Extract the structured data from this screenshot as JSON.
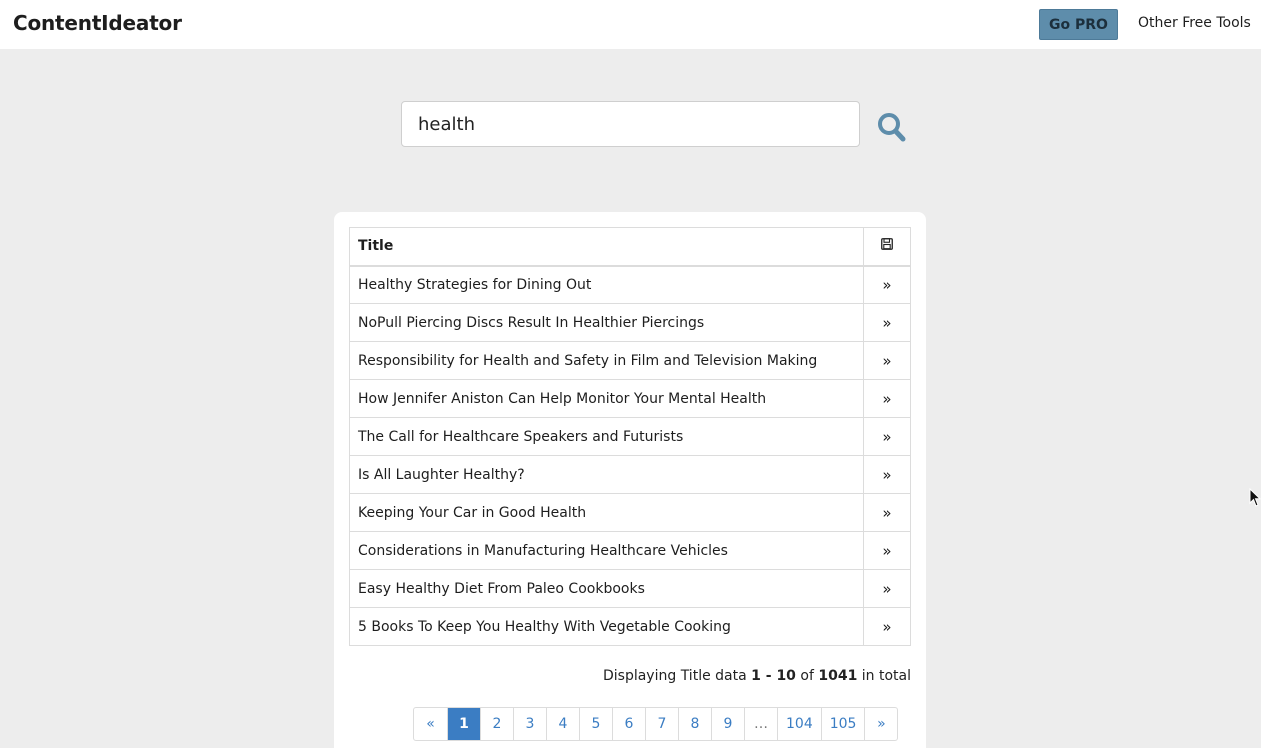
{
  "header": {
    "brand": "ContentIdeator",
    "go_pro_label": "Go PRO",
    "other_tools_label": "Other Free Tools"
  },
  "search": {
    "value": "health",
    "icon": "search-icon",
    "accent": "#5e8dab"
  },
  "table": {
    "column_title": "Title",
    "save_icon": "save-icon",
    "row_action_glyph": "»",
    "rows": [
      "Healthy Strategies for Dining Out",
      "NoPull Piercing Discs Result In Healthier Piercings",
      "Responsibility for Health and Safety in Film and Television Making",
      "How Jennifer Aniston Can Help Monitor Your Mental Health",
      "The Call for Healthcare Speakers and Futurists",
      "Is All Laughter Healthy?",
      "Keeping Your Car in Good Health",
      "Considerations in Manufacturing Healthcare Vehicles",
      "Easy Healthy Diet From Paleo Cookbooks",
      "5 Books To Keep You Healthy With Vegetable Cooking"
    ]
  },
  "summary": {
    "prefix": "Displaying Title data ",
    "range": "1 - 10",
    "of": " of ",
    "total": "1041",
    "suffix": " in total"
  },
  "pagination": {
    "prev": "«",
    "pages": [
      "1",
      "2",
      "3",
      "4",
      "5",
      "6",
      "7",
      "8",
      "9"
    ],
    "ellipsis": "…",
    "tail_pages": [
      "104",
      "105"
    ],
    "next": "»",
    "current": "1",
    "active_color": "#3b7dc3"
  }
}
